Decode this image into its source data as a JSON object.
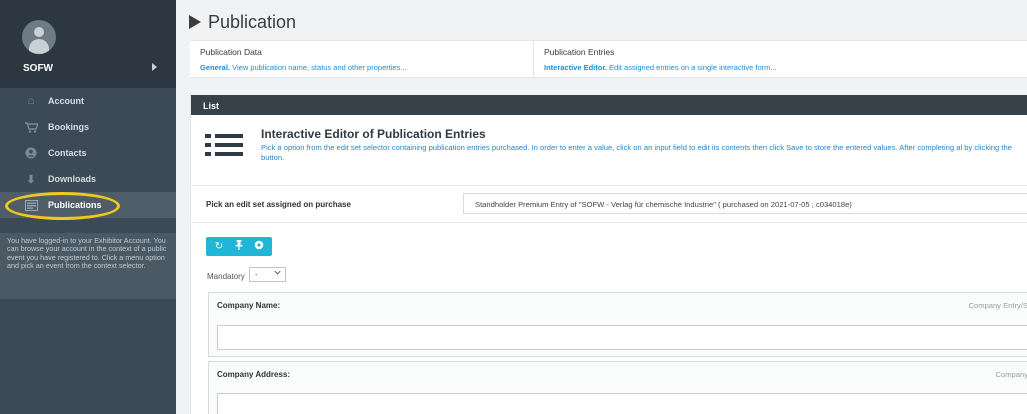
{
  "sidebar": {
    "user": "SOFW",
    "items": [
      {
        "label": "Account",
        "icon": "home-icon",
        "glyph": "⌂"
      },
      {
        "label": "Bookings",
        "icon": "cart-icon",
        "glyph": "🛒"
      },
      {
        "label": "Contacts",
        "icon": "person-icon",
        "glyph": "●"
      },
      {
        "label": "Downloads",
        "icon": "download-icon",
        "glyph": "⬇"
      },
      {
        "label": "Publications",
        "icon": "book-icon",
        "glyph": "▤"
      }
    ],
    "active_index": 4,
    "note": "You have logged-in to your Exhibitor Account. You can browse your account in the context of a public event you have registered to. Click a menu option and pick an event from the context selector."
  },
  "header": {
    "title": "Publication"
  },
  "tabs": [
    {
      "heading": "Publication Data",
      "link_bold": "General.",
      "link_text": "View publication name, status and other properties..."
    },
    {
      "heading": "Publication Entries",
      "link_bold": "Interactive Editor.",
      "link_text": "Edit assigned entries on a single interactive form..."
    }
  ],
  "panel": {
    "heading": "List",
    "editor_title": "Interactive Editor of Publication Entries",
    "editor_desc": "Pick a option from the edit set selector containing publication entries purchased. In order to enter a value, click on an input field to edit its contents then click Save to store the entered values. After completing al by clicking the button.",
    "pick_label": "Pick an edit set assigned on purchase",
    "pick_value": "Standholder Premium Entry of \"SOFW - Verlag für chemische Industrie\" ( purchased on 2021-07-05 ; c034018e)",
    "toolbar": {
      "buttons": [
        {
          "icon": "refresh-icon",
          "glyph": "↻"
        },
        {
          "icon": "pin-icon",
          "glyph": "⬍"
        },
        {
          "icon": "settings-icon",
          "glyph": "✿"
        }
      ]
    },
    "mandatory_label": "Mandatory",
    "mandatory_value": "-",
    "fields": [
      {
        "label": "Company Name:",
        "hint": "Company Entry/S"
      },
      {
        "label": "Company Address:",
        "hint": "Company"
      }
    ]
  },
  "colors": {
    "sidebar_bg": "#3b4a56",
    "panel_header": "#36414a",
    "link_blue": "#1b8fd6",
    "toolbar_cyan": "#21b6d8",
    "highlight_yellow": "#f2c81c"
  }
}
